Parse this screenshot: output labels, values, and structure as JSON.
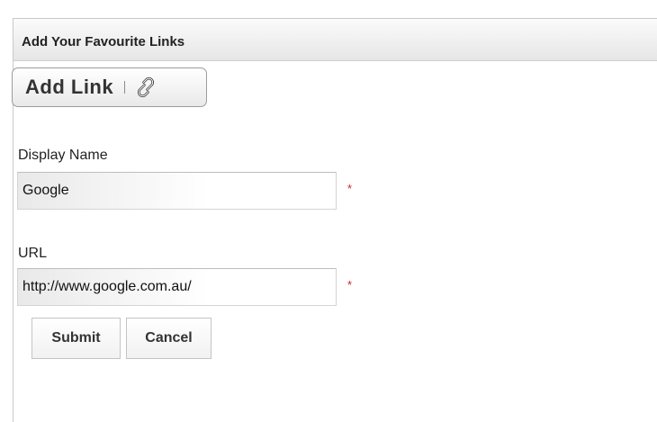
{
  "panel": {
    "title": "Add Your Favourite Links"
  },
  "add_link_button": {
    "label": "Add Link",
    "icon": "link-icon"
  },
  "form": {
    "display_name": {
      "label": "Display Name",
      "value": "Google",
      "required_marker": "*"
    },
    "url": {
      "label": "URL",
      "value": "http://www.google.com.au/",
      "required_marker": "*"
    }
  },
  "actions": {
    "submit_label": "Submit",
    "cancel_label": "Cancel"
  },
  "colors": {
    "required": "#d32020",
    "header_gradient_top": "#fbfbfb",
    "header_gradient_bottom": "#e6e6e6"
  }
}
